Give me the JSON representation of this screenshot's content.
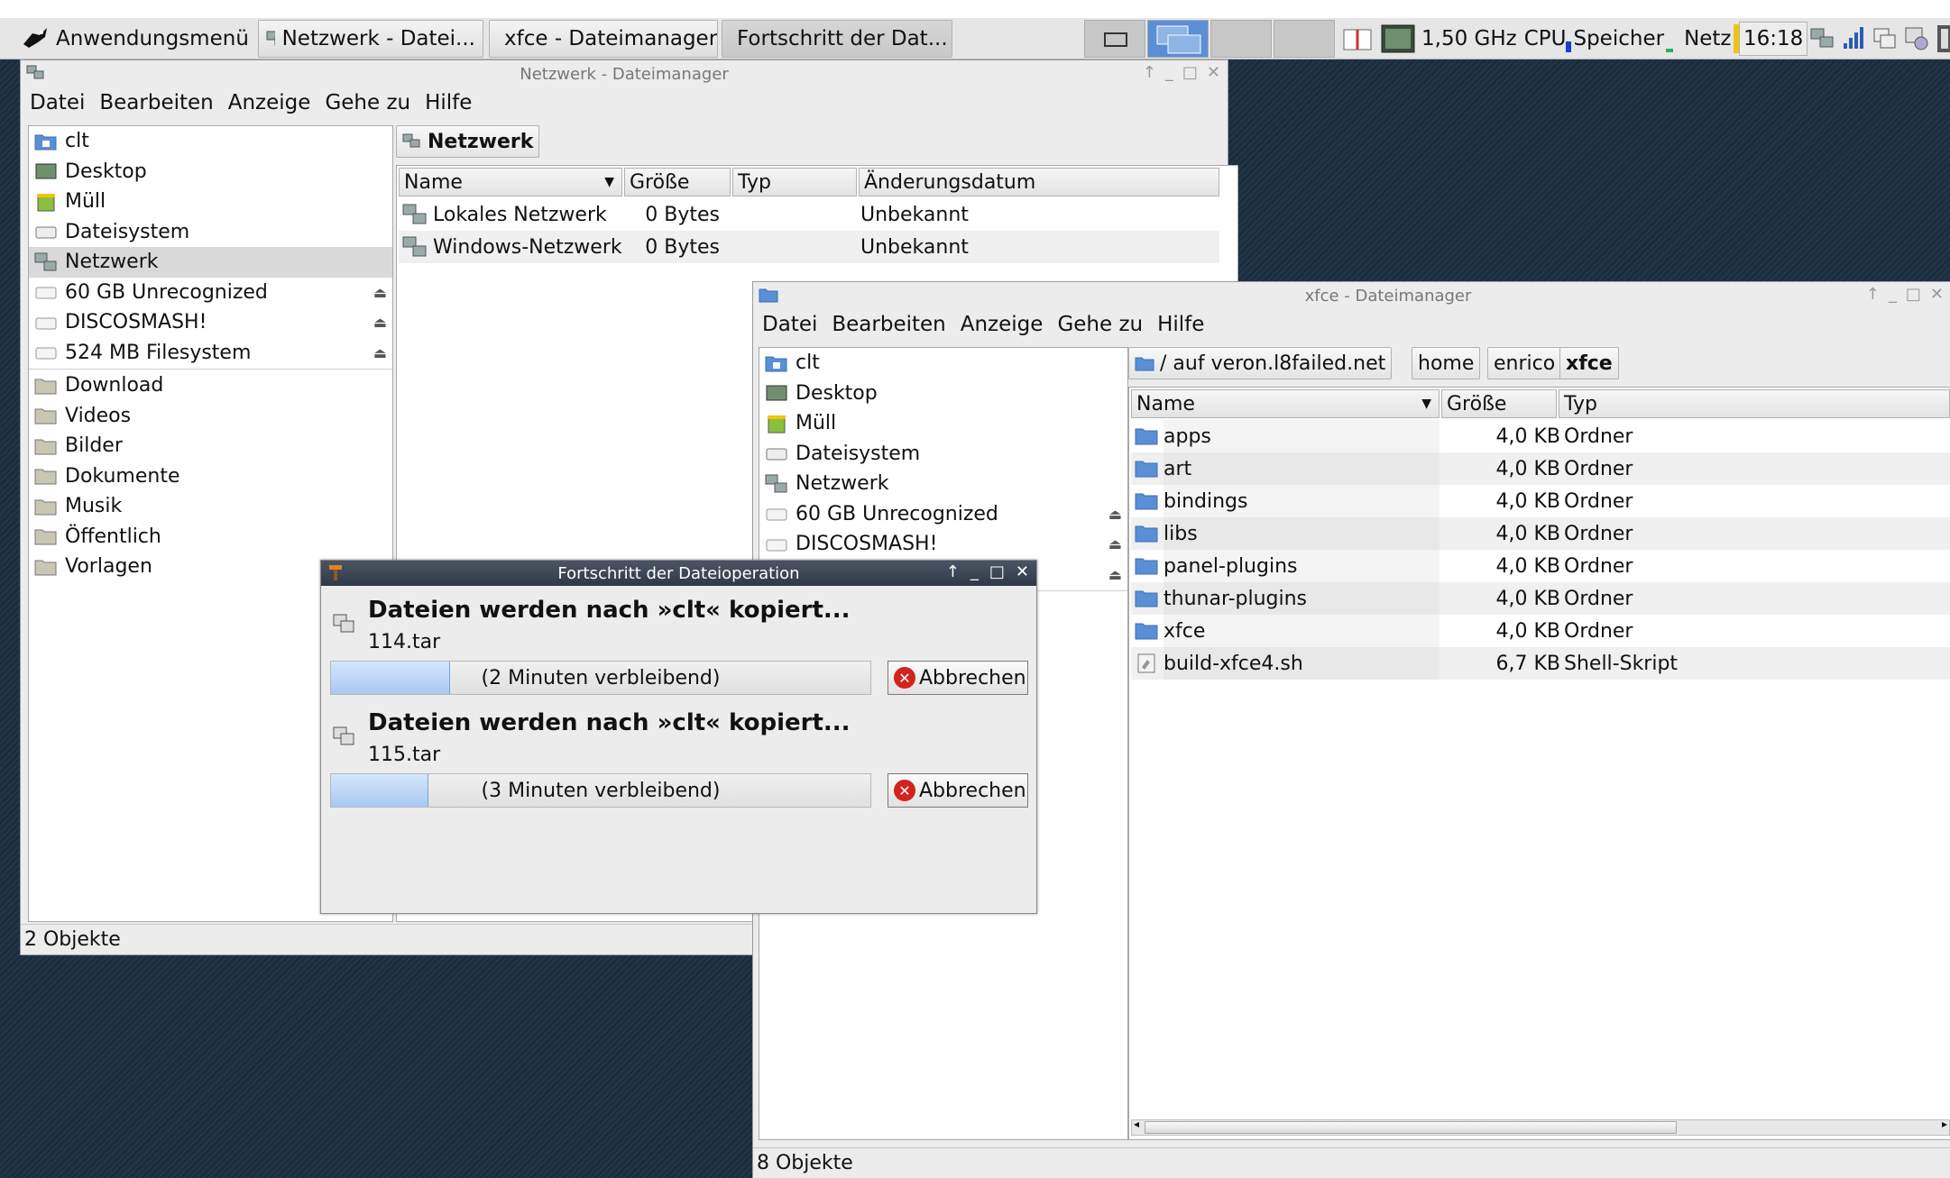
{
  "panel": {
    "app_menu": "Anwendungsmenü",
    "tasks": [
      "Netzwerk - Datei...",
      "xfce - Dateimanager",
      "Fortschritt der Dat..."
    ],
    "cpu_freq": "1,50 GHz",
    "cpu_label": "CPU",
    "mem_label": "Speicher",
    "net_label": "Netz",
    "clock": "16:18"
  },
  "win1": {
    "title": "Netzwerk - Dateimanager",
    "menu": [
      "Datei",
      "Bearbeiten",
      "Anzeige",
      "Gehe zu",
      "Hilfe"
    ],
    "side": [
      "clt",
      "Desktop",
      "Müll",
      "Dateisystem",
      "Netzwerk",
      "60 GB Unrecognized",
      "DISCOSMASH!",
      "524 MB Filesystem",
      "Download",
      "Videos",
      "Bilder",
      "Dokumente",
      "Musik",
      "Öffentlich",
      "Vorlagen"
    ],
    "location": "Netzwerk",
    "columns": [
      "Name",
      "Größe",
      "Typ",
      "Änderungsdatum"
    ],
    "rows": [
      {
        "name": "Lokales Netzwerk",
        "size": "0 Bytes",
        "type": "",
        "date": "Unbekannt"
      },
      {
        "name": "Windows-Netzwerk",
        "size": "0 Bytes",
        "type": "",
        "date": "Unbekannt"
      }
    ],
    "status": "2 Objekte"
  },
  "win2": {
    "title": "xfce - Dateimanager",
    "menu": [
      "Datei",
      "Bearbeiten",
      "Anzeige",
      "Gehe zu",
      "Hilfe"
    ],
    "side": [
      "clt",
      "Desktop",
      "Müll",
      "Dateisystem",
      "Netzwerk",
      "60 GB Unrecognized",
      "DISCOSMASH!"
    ],
    "breadcrumbs": [
      "/ auf veron.l8failed.net",
      "home",
      "enrico",
      "xfce"
    ],
    "columns": [
      "Name",
      "Größe",
      "Typ"
    ],
    "rows": [
      {
        "name": "apps",
        "size": "4,0 KB",
        "type": "Ordner"
      },
      {
        "name": "art",
        "size": "4,0 KB",
        "type": "Ordner"
      },
      {
        "name": "bindings",
        "size": "4,0 KB",
        "type": "Ordner"
      },
      {
        "name": "libs",
        "size": "4,0 KB",
        "type": "Ordner"
      },
      {
        "name": "panel-plugins",
        "size": "4,0 KB",
        "type": "Ordner"
      },
      {
        "name": "thunar-plugins",
        "size": "4,0 KB",
        "type": "Ordner"
      },
      {
        "name": "xfce",
        "size": "4,0 KB",
        "type": "Ordner"
      },
      {
        "name": "build-xfce4.sh",
        "size": "6,7 KB",
        "type": "Shell-Skript"
      }
    ],
    "status": "8 Objekte"
  },
  "dialog": {
    "title": "Fortschritt der Dateioperation",
    "ops": [
      {
        "heading": "Dateien werden nach »clt« kopiert...",
        "file": "114.tar",
        "remaining": "(2 Minuten verbleibend)",
        "progress": 0.22,
        "cancel": "Abbrechen"
      },
      {
        "heading": "Dateien werden nach »clt« kopiert...",
        "file": "115.tar",
        "remaining": "(3 Minuten verbleibend)",
        "progress": 0.18,
        "cancel": "Abbrechen"
      }
    ]
  }
}
